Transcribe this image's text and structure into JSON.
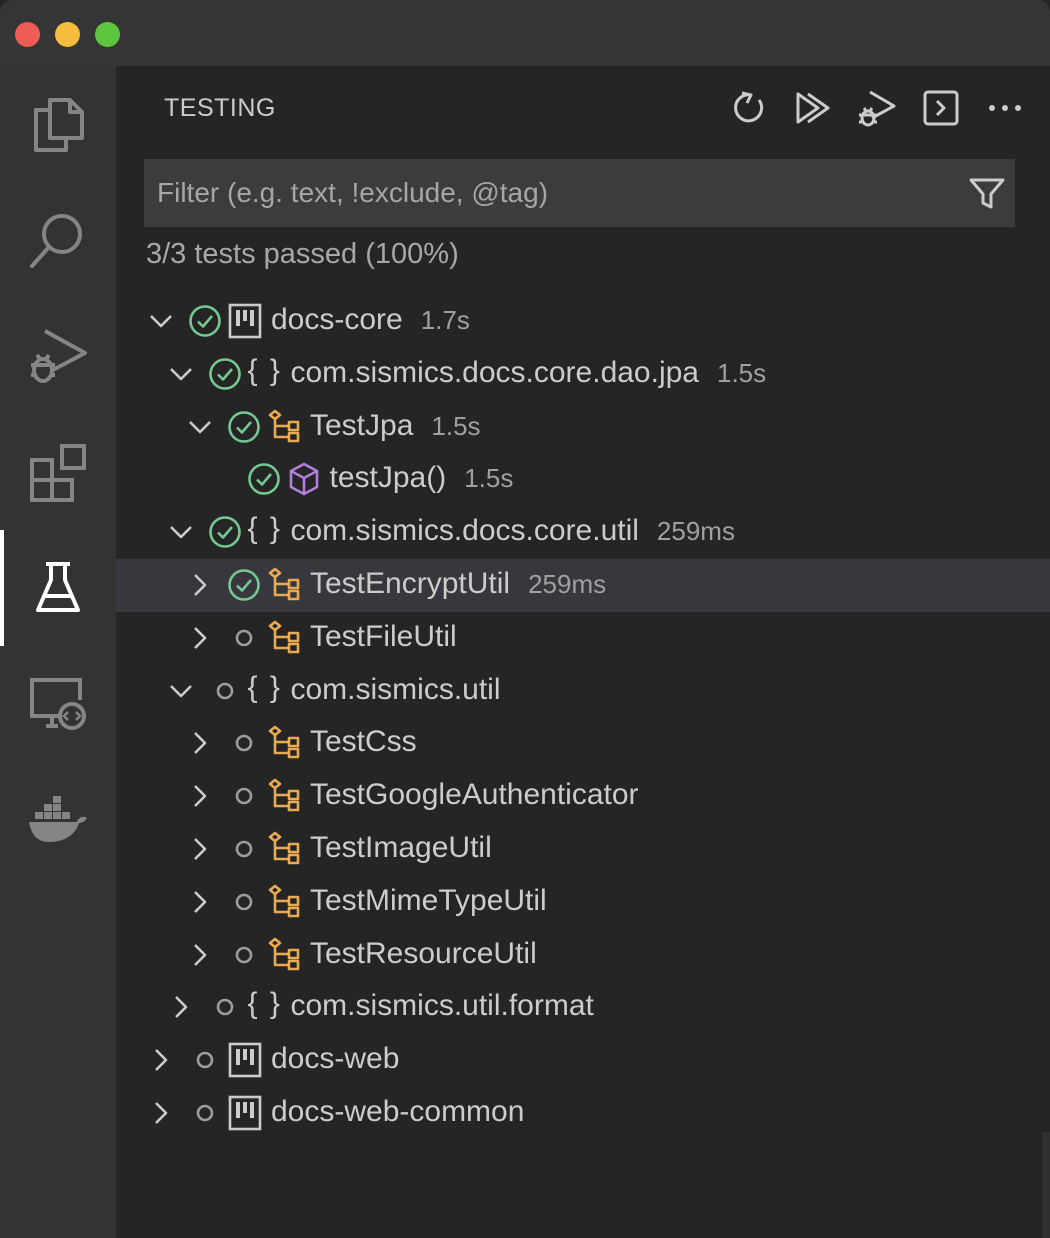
{
  "window": {
    "traffic_colors": [
      "#ee5c55",
      "#f5bd3c",
      "#5ec53e"
    ]
  },
  "activity_bar": {
    "items": [
      {
        "icon": "files-icon",
        "active": false
      },
      {
        "icon": "search-icon",
        "active": false
      },
      {
        "icon": "run-debug-icon",
        "active": false
      },
      {
        "icon": "extensions-icon",
        "active": false
      },
      {
        "icon": "testing-flask-icon",
        "active": true
      },
      {
        "icon": "remote-explorer-icon",
        "active": false
      },
      {
        "icon": "docker-icon",
        "active": false
      }
    ]
  },
  "sidebar": {
    "title": "TESTING",
    "actions": [
      "refresh-icon",
      "run-all-icon",
      "debug-all-icon",
      "terminal-icon",
      "more-icon"
    ],
    "filter": {
      "placeholder": "Filter (e.g. text, !exclude, @tag)",
      "value": ""
    },
    "summary": "3/3 tests passed (100%)",
    "accent_pass": "#73c991",
    "accent_class": "#e8ab53",
    "accent_method": "#b180d7",
    "tree": [
      {
        "label": "docs-core",
        "duration": "1.7s",
        "kind": "module",
        "status": "passed",
        "expanded": true,
        "depth": 0
      },
      {
        "label": "com.sismics.docs.core.dao.jpa",
        "duration": "1.5s",
        "kind": "namespace",
        "kind_text": "{ }",
        "status": "passed",
        "expanded": true,
        "depth": 1
      },
      {
        "label": "TestJpa",
        "duration": "1.5s",
        "kind": "class",
        "status": "passed",
        "expanded": true,
        "depth": 2
      },
      {
        "label": "testJpa()",
        "duration": "1.5s",
        "kind": "method",
        "status": "passed",
        "expanded": null,
        "depth": 3
      },
      {
        "label": "com.sismics.docs.core.util",
        "duration": "259ms",
        "kind": "namespace",
        "kind_text": "{ }",
        "status": "passed",
        "expanded": true,
        "depth": 1
      },
      {
        "label": "TestEncryptUtil",
        "duration": "259ms",
        "kind": "class",
        "status": "passed",
        "expanded": false,
        "depth": 2,
        "selected": true
      },
      {
        "label": "TestFileUtil",
        "duration": "",
        "kind": "class",
        "status": "unset",
        "expanded": false,
        "depth": 2
      },
      {
        "label": "com.sismics.util",
        "duration": "",
        "kind": "namespace",
        "kind_text": "{ }",
        "status": "unset",
        "expanded": true,
        "depth": 1
      },
      {
        "label": "TestCss",
        "duration": "",
        "kind": "class",
        "status": "unset",
        "expanded": false,
        "depth": 2
      },
      {
        "label": "TestGoogleAuthenticator",
        "duration": "",
        "kind": "class",
        "status": "unset",
        "expanded": false,
        "depth": 2
      },
      {
        "label": "TestImageUtil",
        "duration": "",
        "kind": "class",
        "status": "unset",
        "expanded": false,
        "depth": 2
      },
      {
        "label": "TestMimeTypeUtil",
        "duration": "",
        "kind": "class",
        "status": "unset",
        "expanded": false,
        "depth": 2
      },
      {
        "label": "TestResourceUtil",
        "duration": "",
        "kind": "class",
        "status": "unset",
        "expanded": false,
        "depth": 2
      },
      {
        "label": "com.sismics.util.format",
        "duration": "",
        "kind": "namespace",
        "kind_text": "{ }",
        "status": "unset",
        "expanded": false,
        "depth": 1
      },
      {
        "label": "docs-web",
        "duration": "",
        "kind": "module",
        "status": "unset",
        "expanded": false,
        "depth": 0
      },
      {
        "label": "docs-web-common",
        "duration": "",
        "kind": "module",
        "status": "unset",
        "expanded": false,
        "depth": 0
      }
    ]
  }
}
